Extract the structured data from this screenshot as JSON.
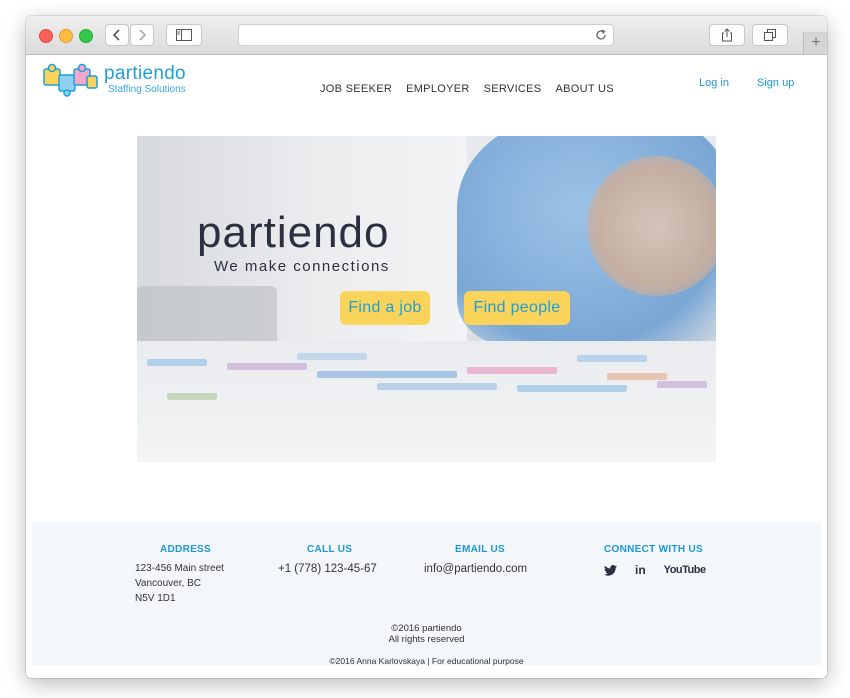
{
  "browser": {
    "back_icon": "chevron-left-icon",
    "forward_icon": "chevron-right-icon",
    "sidebar_icon": "sidebar-icon",
    "reload_icon": "reload-icon",
    "share_icon": "share-icon",
    "tabs_icon": "tabs-icon",
    "new_tab": "+",
    "url": ""
  },
  "header": {
    "logo_name": "partiendo",
    "logo_tagline": "Staffing Solutions",
    "menu": [
      "JOB SEEKER",
      "EMPLOYER",
      "SERVICES",
      "ABOUT US"
    ],
    "login": "Log in",
    "signup": "Sign up"
  },
  "hero": {
    "title": "partiendo",
    "subtitle": "We make connections",
    "find_job": "Find a job",
    "find_people": "Find people"
  },
  "footer": {
    "address_heading": "ADDRESS",
    "address_lines": [
      "123-456 Main street",
      "Vancouver, BC",
      "N5V 1D1"
    ],
    "call_heading": "CALL US",
    "phone": "+1 (778) 123-45-67",
    "email_heading": "EMAIL US",
    "email": "info@partiendo.com",
    "connect_heading": "CONNECT WITH US",
    "social": [
      "twitter-icon",
      "linkedin-icon",
      "youtube-icon"
    ],
    "linkedin_text": "in",
    "youtube_text": "YouTube",
    "copyright_line1": "©2016 partiendo",
    "copyright_line2": "All rights reserved",
    "credit": "©2016 Anna Karlovskaya | For educational purpose"
  },
  "colors": {
    "accent": "#1f9fd8",
    "button": "#f9d35a",
    "footer_bg": "#f3f7fa",
    "text": "#333333"
  }
}
